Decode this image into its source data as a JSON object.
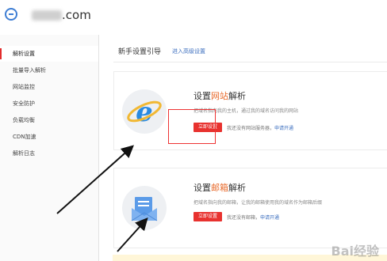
{
  "header": {
    "domain_suffix": ".com"
  },
  "sidebar": {
    "items": [
      {
        "label": "解析设置",
        "active": true
      },
      {
        "label": "批量导入解析"
      },
      {
        "label": "网站监控"
      },
      {
        "label": "安全防护"
      },
      {
        "label": "负载均衡"
      },
      {
        "label": "CDN加速"
      },
      {
        "label": "解析日志"
      }
    ]
  },
  "main": {
    "title": "新手设置引导",
    "advanced_link": "进入高级设置",
    "cards": [
      {
        "title_prefix": "设置",
        "title_highlight": "网站",
        "title_suffix": "解析",
        "description": "把域名指向我的主机，通过我的域名访问我的网站",
        "button": "立即设置",
        "note_text": "我还没有网站服务器，",
        "note_link": "申请开通",
        "icon": "ie-browser-icon"
      },
      {
        "title_prefix": "设置",
        "title_highlight": "邮箱",
        "title_suffix": "解析",
        "description": "把域名指向我的邮箱，让我的邮箱使用我的域名作为邮箱后缀",
        "button": "立即设置",
        "note_text": "我还没有邮箱，",
        "note_link": "申请开通",
        "icon": "mail-icon"
      }
    ]
  },
  "watermark": "Bai经验",
  "colors": {
    "accent": "#e8322f",
    "link": "#3d6fbf",
    "highlight": "#e86a2b"
  }
}
